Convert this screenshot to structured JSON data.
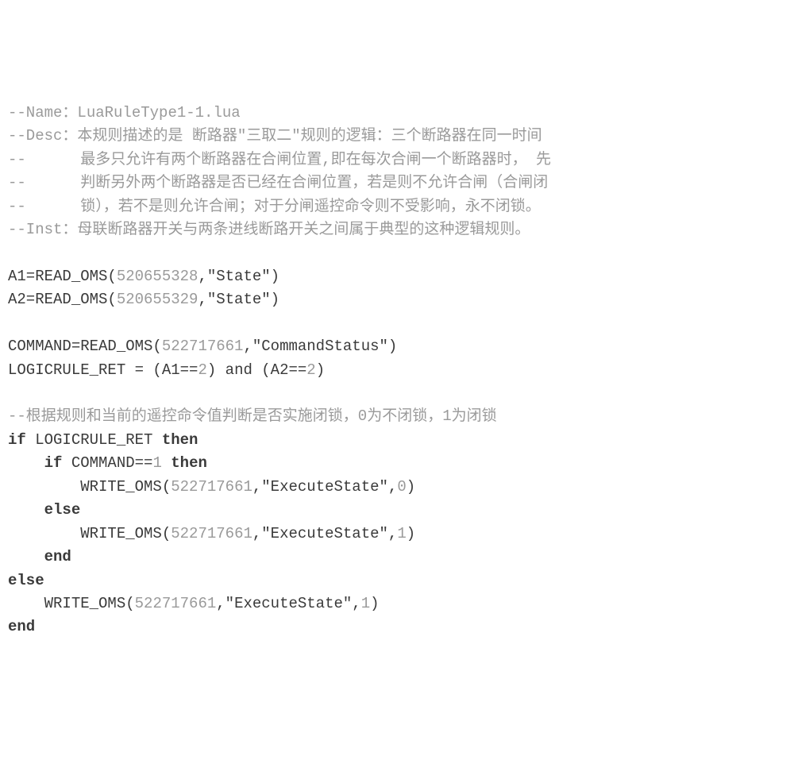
{
  "code": {
    "filename": "LuaRuleType1-1.lua",
    "header": {
      "name_label": "--Name：",
      "desc_label": "--Desc：",
      "inst_label": "--Inst：",
      "cont_prefix": "--      ",
      "desc_line1": "本规则描述的是 断路器\"三取二\"规则的逻辑：三个断路器在同一时间",
      "desc_line2": "最多只允许有两个断路器在合闸位置,即在每次合闸一个断路器时， 先",
      "desc_line3": "判断另外两个断路器是否已经在合闸位置，若是则不允许合闸（合闸闭",
      "desc_line4": "锁），若不是则允许合闸；对于分闸遥控命令则不受影响，永不闭锁。",
      "inst_line": "母联断路器开关与两条进线断路开关之间属于典型的这种逻辑规则。"
    },
    "reads": {
      "a1_lhs": "A1=READ_OMS(",
      "a1_id": "520655328",
      "a1_rest": ",\"State\")",
      "a2_lhs": "A2=READ_OMS(",
      "a2_id": "520655329",
      "a2_rest": ",\"State\")",
      "cmd_lhs": "COMMAND=READ_OMS(",
      "cmd_id": "522717661",
      "cmd_rest": ",\"CommandStatus\")"
    },
    "logic": {
      "rule_lhs": "LOGICRULE_RET = (A1==",
      "two_a": "2",
      "rule_mid": ") and (A2==",
      "two_b": "2",
      "rule_end": ")"
    },
    "inline_comment": "--根据规则和当前的遥控命令值判断是否实施闭锁，0为不闭锁，1为闭锁",
    "kw": {
      "if": "if",
      "then": "then",
      "else": "else",
      "end": "end",
      "and": "and"
    },
    "body": {
      "if1_cond": " LOGICRULE_RET ",
      "if2_indent": "    ",
      "if2_cond": " COMMAND==",
      "if2_val": "1",
      "if2_space": " ",
      "write1_indent": "        ",
      "write1_pre": "WRITE_OMS(",
      "write1_id": "522717661",
      "write1_mid": ",\"ExecuteState\",",
      "write1_val": "0",
      "write1_end": ")",
      "else1_indent": "    ",
      "write2_indent": "        ",
      "write2_pre": "WRITE_OMS(",
      "write2_id": "522717661",
      "write2_mid": ",\"ExecuteState\",",
      "write2_val": "1",
      "write2_end": ")",
      "end1_indent": "    ",
      "write3_indent": "    ",
      "write3_pre": "WRITE_OMS(",
      "write3_id": "522717661",
      "write3_mid": ",\"ExecuteState\",",
      "write3_val": "1",
      "write3_end": ")"
    }
  }
}
